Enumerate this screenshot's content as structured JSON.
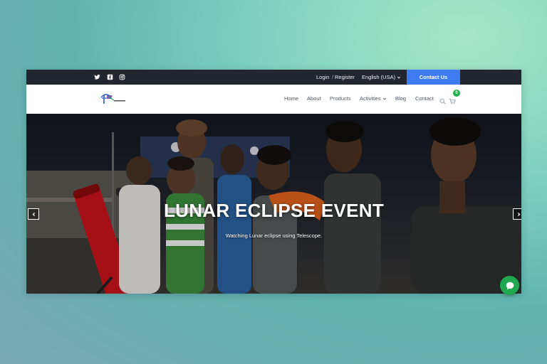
{
  "topbar": {
    "social_icons": [
      "twitter-icon",
      "facebook-icon",
      "instagram-icon"
    ],
    "login": "Login",
    "separator": "/",
    "register": "Register",
    "language": "English (USA)",
    "contact_button": "Contact Us"
  },
  "nav": {
    "items": [
      "Home",
      "About",
      "Products",
      "Activities",
      "Blog",
      "Contact"
    ],
    "cart_count": "0"
  },
  "hero": {
    "title": "LUNAR ECLIPSE EVENT",
    "subtitle": "Watching Lunar eclipse using Telescope."
  },
  "colors": {
    "topbar_bg": "#22262e",
    "accent_blue": "#3f7cf4",
    "cart_badge": "#23b14d",
    "chat_button": "#1fa84f"
  }
}
